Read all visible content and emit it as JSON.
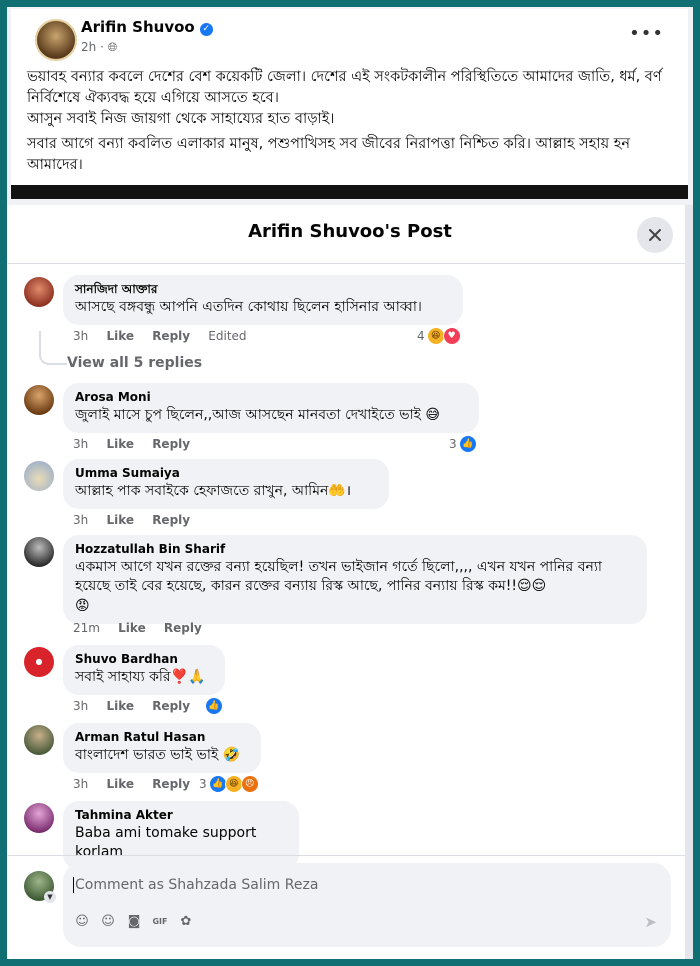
{
  "post": {
    "author": "Arifin Shuvoo",
    "time": "2h",
    "audience_icon": "globe-icon",
    "paragraphs": [
      "ভয়াবহ বন্যার কবলে দেশের বেশ কয়েকটি জেলা। দেশের এই সংকটকালীন পরিস্থিতিতে আমাদের জাতি, ধর্ম, বর্ণ নির্বিশেষে ঐক্যবদ্ধ হয়ে এগিয়ে আসতে হবে।",
      "আসুন সবাই নিজ জায়গা থেকে সাহায্যের হাত বাড়াই।",
      "সবার আগে বন্যা কবলিত এলাকার মানুষ, পশুপাখিসহ সব জীবের নিরাপত্তা নিশ্চিত করি। আল্লাহ সহায় হন আমাদের।"
    ]
  },
  "modal": {
    "title": "Arifin Shuvoo's Post",
    "close_icon": "close-icon"
  },
  "labels": {
    "like": "Like",
    "reply": "Reply",
    "edited": "Edited"
  },
  "comments": [
    {
      "name": "সানজিদা আক্তার",
      "text": "আসছে বঙ্গবন্ধু আপনি এতদিন কোথায় ছিলেন হাসিনার আব্বা।",
      "time": "3h",
      "reaction_count": "4",
      "edited": true,
      "avatar_color": "#b5503c"
    },
    {
      "name": "Arosa Moni",
      "text": "জুলাই মাসে চুপ ছিলেন,,আজ আসছেন মানবতা দেখাইতে ভাই 😅",
      "time": "3h",
      "reaction_count": "3",
      "avatar_color": "#7a4a1e"
    },
    {
      "name": "Umma Sumaiya",
      "text": "আল্লাহ পাক সবাইকে হেফাজতে রাখুন, আমিন🤲।",
      "time": "3h",
      "reaction_count": "",
      "avatar_color": "#c9b98d"
    },
    {
      "name": "Hozzatullah Bin Sharif",
      "text": "একমাস আগে যখন রক্তের বন্যা হয়েছিল! তখন ভাইজান গর্তে ছিলো,,,, এখন যখন পানির বন্যা হয়েছে তাই বের হয়েছে, কারন রক্তের বন্যায় রিস্ক আছে, পানির বন্যায় রিস্ক কম!!😌😌",
      "extra": "😡",
      "time": "21m",
      "reaction_count": "",
      "avatar_color": "#3a3a3a"
    },
    {
      "name": "Shuvo Bardhan",
      "text": "সবাই সাহায্য করি❣️🙏",
      "time": "3h",
      "reaction_count": "",
      "avatar_color": "#d8232a"
    },
    {
      "name": "Arman Ratul Hasan",
      "text": "বাংলাদেশ ভারত ভাই ভাই 🤣",
      "time": "3h",
      "reaction_count": "3",
      "avatar_color": "#6d7b5a"
    },
    {
      "name": "Tahmina Akter",
      "text": "Baba ami tomake support korlam",
      "time": "",
      "reaction_count": "",
      "avatar_color": "#b04a9a"
    }
  ],
  "view_replies": "View all 5 replies",
  "composer": {
    "placeholder": "Comment as Shahzada Salim Reza",
    "tools": [
      "avatar-sticker-icon",
      "emoji-icon",
      "camera-icon",
      "gif-icon",
      "sticker-icon"
    ],
    "send_icon": "send-icon"
  }
}
